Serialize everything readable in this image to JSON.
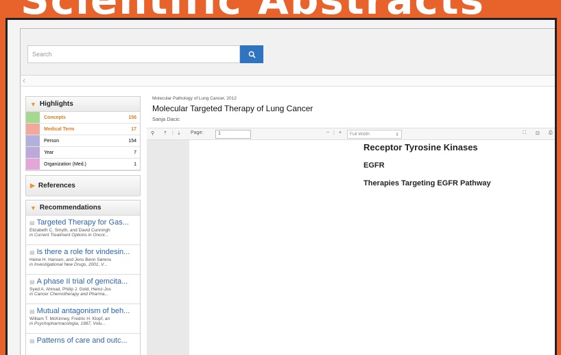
{
  "banner": {
    "text": "Scientific Abstracts"
  },
  "search": {
    "placeholder": "Search"
  },
  "sidebar": {
    "highlights": {
      "title": "Highlights",
      "rows": [
        {
          "label": "Concepts",
          "count": "156",
          "color": "#a6d98f"
        },
        {
          "label": "Medical Term",
          "count": "17",
          "color": "#f0a99a"
        },
        {
          "label": "Person",
          "count": "154",
          "color": "#b4b0dc"
        },
        {
          "label": "Year",
          "count": "7",
          "color": "#bba9da"
        },
        {
          "label": "Organization (Med.)",
          "count": "1",
          "color": "#e4a6d6"
        }
      ]
    },
    "references": {
      "title": "References"
    },
    "recommendations": {
      "title": "Recommendations",
      "items": [
        {
          "title": "Targeted Therapy for Gas...",
          "authors": "Elizabeth C. Smyth, and David Cunningh",
          "source": "in Current Treatment Options in Oncol..."
        },
        {
          "title": "Is there a role for vindesin...",
          "authors": "Heine H. Hansen, and Jens Benn Sørens",
          "source": "in Investigational New Drugs, 2001, V..."
        },
        {
          "title": "A phase II trial of gemcita...",
          "authors": "Syed A. Ahmad, Philip J. Gold, Heinz-Jos",
          "source": "in Cancer Chemotherapy and Pharma..."
        },
        {
          "title": "Mutual antagonism of beh...",
          "authors": "William T. McKinney, Fredric H. Klopf, an",
          "source": "in Psychopharmacologia, 1987, Volu..."
        },
        {
          "title": "Patterns of care and outc...",
          "authors": "",
          "source": ""
        }
      ]
    }
  },
  "document": {
    "source": "Molecular Pathology of Lung Cancer, 2012",
    "title": "Molecular Targeted Therapy of Lung Cancer",
    "author": "Sanja Dacic",
    "toolbar": {
      "page_label": "Page:",
      "page_value": "1",
      "zoom_value": "Full Width"
    },
    "col2": {
      "heading": "Receptor Tyrosine Kinases",
      "subheading": "EGFR",
      "heading2": "Therapies Targeting EGFR Pathway"
    }
  }
}
